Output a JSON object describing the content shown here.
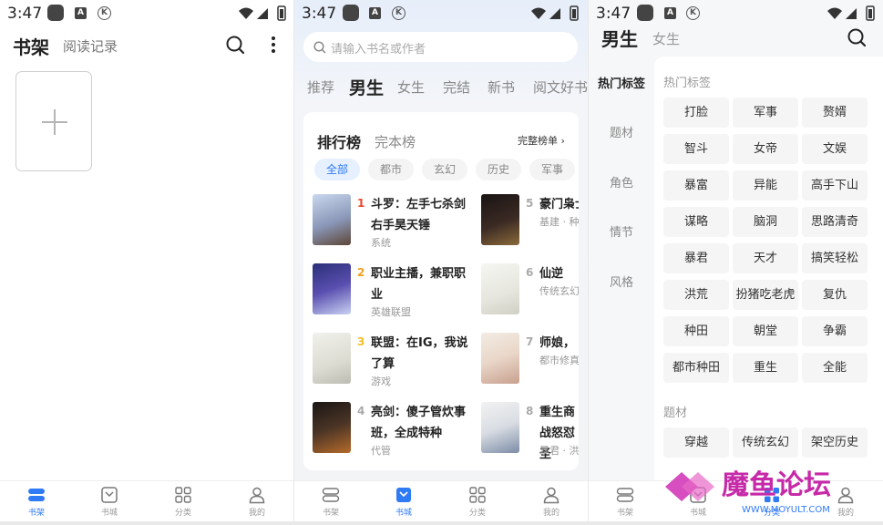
{
  "status": {
    "time": "3:47",
    "a_badge": "A",
    "k_badge": "K"
  },
  "bookshelf": {
    "title": "书架",
    "reading_history": "阅读记录"
  },
  "tabs": {
    "shelf": "书架",
    "store": "书城",
    "category": "分类",
    "mine": "我的"
  },
  "store": {
    "search_placeholder": "请输入书名或作者",
    "categories": [
      "推荐",
      "男生",
      "女生",
      "完结",
      "新书",
      "阅文好书"
    ],
    "ranking": {
      "title": "排行榜",
      "alt_title": "完本榜",
      "more": "完整榜单",
      "filters": [
        "全部",
        "都市",
        "玄幻",
        "历史",
        "军事"
      ],
      "books": [
        {
          "rank": "1",
          "title": "斗罗：左手七杀剑右手昊天锤",
          "tag": "系统"
        },
        {
          "rank": "2",
          "title": "职业主播，兼职职业",
          "tag": "英雄联盟"
        },
        {
          "rank": "3",
          "title": "联盟：在IG，我说了算",
          "tag": "游戏"
        },
        {
          "rank": "4",
          "title": "亮剑：傻子管炊事班，全成特种",
          "tag": "代管"
        },
        {
          "rank": "5",
          "title": "豪门枭士",
          "tag": "基建 · 种"
        },
        {
          "rank": "6",
          "title": "仙逆",
          "tag": "传统玄幻"
        },
        {
          "rank": "7",
          "title": "师娘，",
          "tag": "都市修真"
        },
        {
          "rank": "8",
          "title": "重生商战怒怼圣",
          "tag": "暴君 · 洪"
        }
      ]
    }
  },
  "category": {
    "title": "男生",
    "alt": "女生",
    "sidenav": [
      "热门标签",
      "题材",
      "角色",
      "情节",
      "风格"
    ],
    "hot_label": "热门标签",
    "hot_tags": [
      "打脸",
      "军事",
      "赘婿",
      "智斗",
      "女帝",
      "文娱",
      "暴富",
      "异能",
      "高手下山",
      "谋略",
      "脑洞",
      "思路清奇",
      "暴君",
      "天才",
      "搞笑轻松",
      "洪荒",
      "扮猪吃老虎",
      "复仇",
      "种田",
      "朝堂",
      "争霸",
      "都市种田",
      "重生",
      "全能"
    ],
    "theme_label": "题材",
    "theme_tags": [
      "穿越",
      "传统玄幻",
      "架空历史"
    ]
  },
  "watermark": {
    "brand": "魔鱼论坛",
    "url": "WWW.MOYULT.COM"
  },
  "colors": {
    "accent": "#2f7af5",
    "rank_red": "#e8452e",
    "rank_orange": "#f0a020",
    "rank_yellow": "#f2c02a"
  }
}
